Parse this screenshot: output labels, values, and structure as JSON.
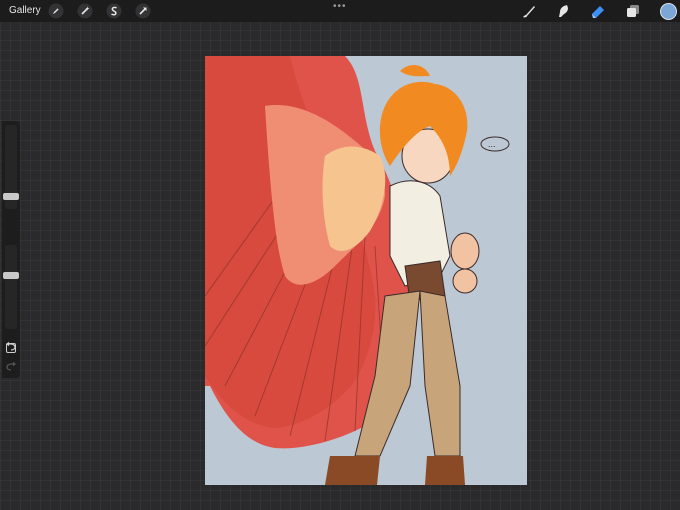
{
  "toolbar": {
    "gallery_label": "Gallery",
    "more_label": "•••",
    "left_tools": [
      "wrench-icon",
      "magic-wand-icon",
      "selection-icon",
      "transform-arrow-icon"
    ],
    "right_tools": [
      "brush-icon",
      "smudge-icon",
      "eraser-icon",
      "layers-icon"
    ],
    "active_tool": "eraser-icon",
    "current_color": "#7aa7d6"
  },
  "sidebar": {
    "brush_size": 0.2,
    "opacity": 0.7,
    "icons": [
      "modify-button-icon",
      "undo-icon",
      "redo-icon"
    ]
  },
  "canvas": {
    "artwork": "illustration",
    "background": "#bcc8d3",
    "speech_bubble_text": "..."
  }
}
